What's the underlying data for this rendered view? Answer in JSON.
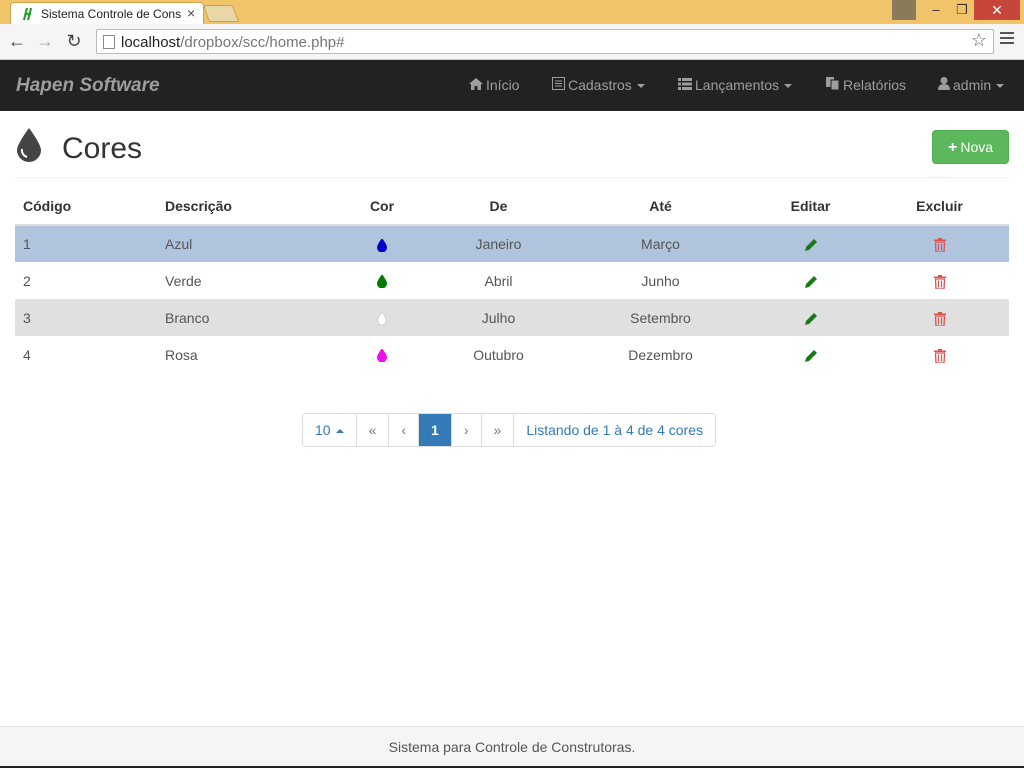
{
  "browser": {
    "tab_title": "Sistema Controle de Cons",
    "url_host": "localhost",
    "url_path": "/dropbox/scc/home.php#",
    "close_glyph": "×",
    "win_minimize": "–",
    "win_restore": "❐",
    "win_close": "✕"
  },
  "navbar": {
    "brand": "Hapen Software",
    "items": [
      {
        "label": "Início",
        "icon": "home-icon"
      },
      {
        "label": "Cadastros",
        "icon": "list-alt-icon"
      },
      {
        "label": "Lançamentos",
        "icon": "list-icon"
      },
      {
        "label": "Relatórios",
        "icon": "copy-icon"
      },
      {
        "label": "admin",
        "icon": "user-icon"
      }
    ]
  },
  "page": {
    "title": "Cores",
    "new_button": "Nova"
  },
  "table": {
    "headers": [
      "Código",
      "Descrição",
      "Cor",
      "De",
      "Até",
      "Editar",
      "Excluir"
    ],
    "rows": [
      {
        "codigo": "1",
        "descricao": "Azul",
        "cor": "#0000cc",
        "de": "Janeiro",
        "ate": "Março"
      },
      {
        "codigo": "2",
        "descricao": "Verde",
        "cor": "#007a00",
        "de": "Abril",
        "ate": "Junho"
      },
      {
        "codigo": "3",
        "descricao": "Branco",
        "cor": "#ffffff",
        "de": "Julho",
        "ate": "Setembro"
      },
      {
        "codigo": "4",
        "descricao": "Rosa",
        "cor": "#ee11ee",
        "de": "Outubro",
        "ate": "Dezembro"
      }
    ]
  },
  "pagination": {
    "page_size": "10",
    "first": "«",
    "prev": "‹",
    "current": "1",
    "next": "›",
    "last": "»",
    "summary": "Listando de 1 à 4 de 4 cores"
  },
  "footer": {
    "text": "Sistema para Controle de Construtoras."
  },
  "colors": {
    "navbar_bg": "#222222",
    "success": "#5cb85c",
    "primary": "#337ab7",
    "edit": "#1a7a1a",
    "delete": "#d9534f",
    "selected_row": "#b0c4de"
  }
}
